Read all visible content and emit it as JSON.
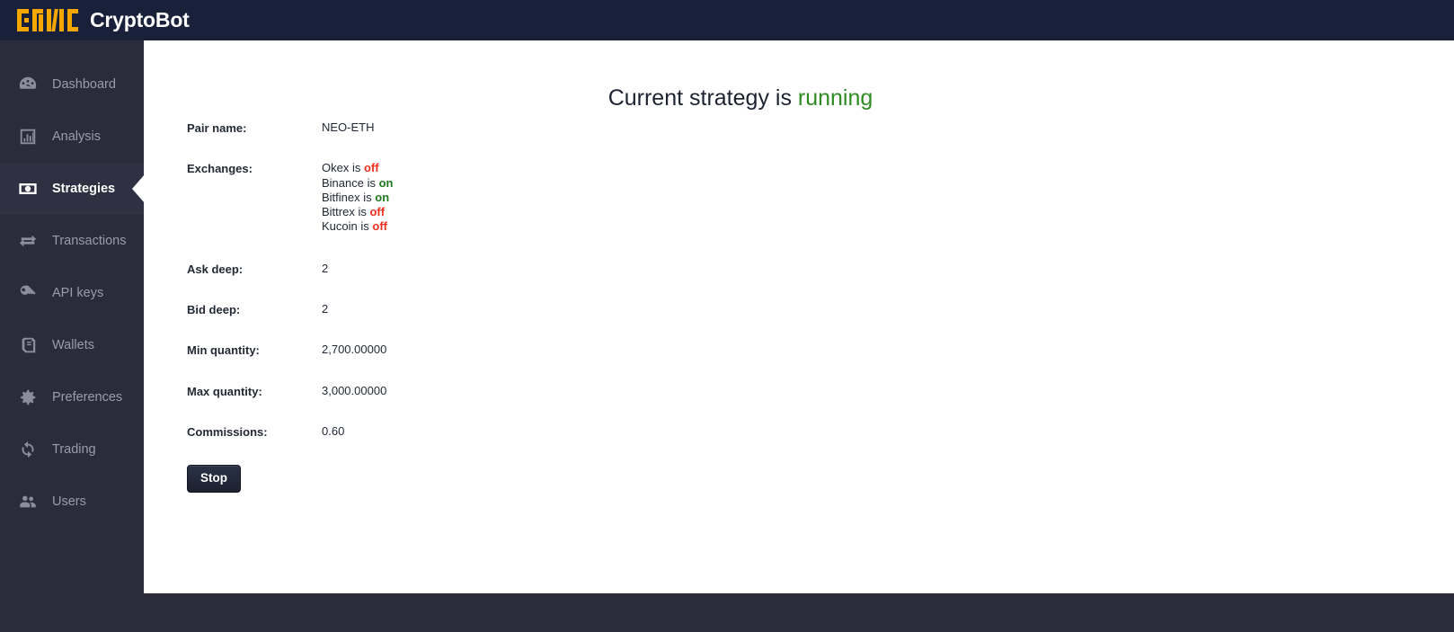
{
  "header": {
    "brand_title": "CryptoBot",
    "logo_icon": "gnc-blocks-logo"
  },
  "sidebar": {
    "items": [
      {
        "label": "Dashboard",
        "icon": "dashboard-gauge-icon",
        "active": false
      },
      {
        "label": "Analysis",
        "icon": "bar-chart-icon",
        "active": false
      },
      {
        "label": "Strategies",
        "icon": "banknote-icon",
        "active": true
      },
      {
        "label": "Transactions",
        "icon": "exchange-arrows-icon",
        "active": false
      },
      {
        "label": "API keys",
        "icon": "key-icon",
        "active": false
      },
      {
        "label": "Wallets",
        "icon": "wallet-book-icon",
        "active": false
      },
      {
        "label": "Preferences",
        "icon": "gear-icon",
        "active": false
      },
      {
        "label": "Trading",
        "icon": "refresh-cycle-icon",
        "active": false
      },
      {
        "label": "Users",
        "icon": "users-group-icon",
        "active": false
      }
    ]
  },
  "main": {
    "status_prefix": "Current strategy is ",
    "status_state": "running",
    "status_color": "#2e8b22",
    "rows": [
      {
        "label": "Pair name:",
        "value": "NEO-ETH"
      },
      {
        "label": "Ask deep:",
        "value": "2"
      },
      {
        "label": "Bid deep:",
        "value": "2"
      },
      {
        "label": "Min quantity:",
        "value": "2,700.00000"
      },
      {
        "label": "Max quantity:",
        "value": "3,000.00000"
      },
      {
        "label": "Commissions:",
        "value": "0.60"
      }
    ],
    "exchanges_label": "Exchanges:",
    "exchanges": [
      {
        "name": "Okex",
        "prefix": "Okex is ",
        "state": "off"
      },
      {
        "name": "Binance",
        "prefix": "Binance is ",
        "state": "on"
      },
      {
        "name": "Bitfinex",
        "prefix": "Bitfinex is ",
        "state": "on"
      },
      {
        "name": "Bittrex",
        "prefix": "Bittrex is ",
        "state": "off"
      },
      {
        "name": "Kucoin",
        "prefix": "Kucoin is ",
        "state": "off"
      }
    ],
    "stop_button_label": "Stop"
  },
  "colors": {
    "brand_orange": "#f5a700",
    "topbar": "#19213a",
    "sidebar": "#2b2b3b",
    "sidebar_active": "#2f3042",
    "on_green": "#1f7a1f",
    "off_red": "#f03020"
  }
}
